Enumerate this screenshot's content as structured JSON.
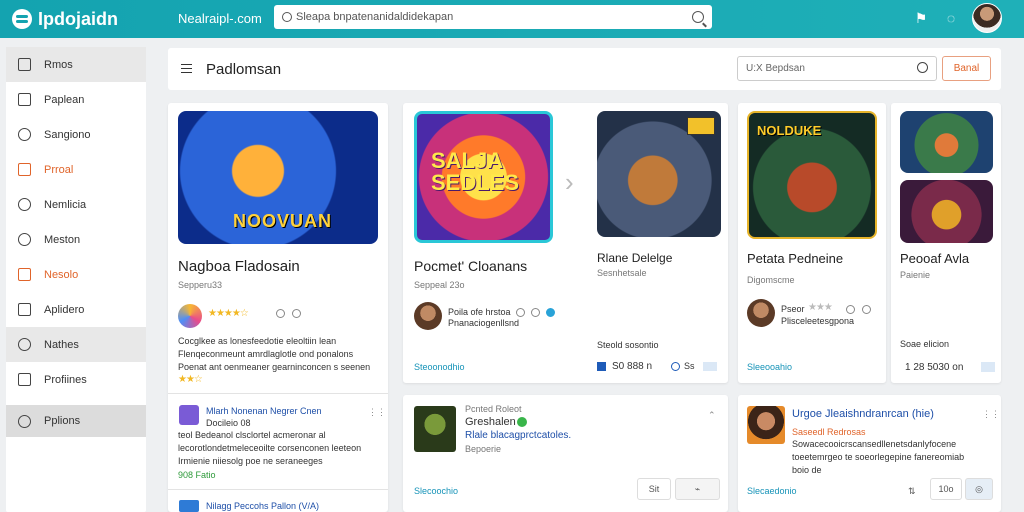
{
  "app": {
    "title": "Ipdojaidn",
    "subtitle": "Nealraipl-.com"
  },
  "search": {
    "placeholder": "Sleapa bnpatenanidaldidekapan"
  },
  "sidebar": {
    "items": [
      {
        "label": "Rmos",
        "icon": "square-icon"
      },
      {
        "label": "Paplean",
        "icon": "list-icon"
      },
      {
        "label": "Sangiono",
        "icon": "circle-icon"
      },
      {
        "label": "Prroal",
        "icon": "shield-icon",
        "accent": true
      },
      {
        "label": "Nemlicia",
        "icon": "clock-icon"
      },
      {
        "label": "Meston",
        "icon": "globe-icon"
      },
      {
        "label": "Nesolo",
        "icon": "calendar-icon",
        "accent": true
      },
      {
        "label": "Aplidero",
        "icon": "grid-icon"
      },
      {
        "label": "Nathes",
        "icon": "chat-icon"
      },
      {
        "label": "Profiines",
        "icon": "file-icon"
      },
      {
        "label": "Pplions",
        "icon": "search-icon"
      }
    ]
  },
  "header": {
    "title": "Padlomsan",
    "filter_placeholder": "U:X Bepdsan",
    "button": "Banal"
  },
  "cards": {
    "c1": {
      "title": "Nagboa Fladosain",
      "sub": "Sepperu33",
      "desc": "Cocglkee as lonesfeedotie eleoltiin lean\nFlenqeconmeunt amrdlaglotle ond ponalons\nPoenat ant oenmeaner gearninconcen s seenen",
      "list1_title": "Mlarh Nonenan Negrer Cnen",
      "list1_sub": "Docileio 08",
      "list1_desc": "teol Bedeanol clsclortel acmeronar al\nlecorotlondetmeleceoilte corsenconen leeteon\nIrmienie niiesolg poe ne seraneeges",
      "list1_tag": "908 Fatio",
      "list2_title": "Nilagg Peccohs Pallon (V/A)"
    },
    "c2": {
      "title": "Pocmet' Cloanans",
      "sub": "Seppeal 23o",
      "meta1": "Poila ofe hrstoa",
      "meta2": "Pnanaciogenllsnd",
      "link": "Steoonodhio",
      "title2": "Rlane Delelge",
      "sub2": "Sesnhetsale",
      "small2": "Steold sosontio",
      "price": "S0 888 n",
      "badge": "Ss"
    },
    "c3": {
      "title": "Petata Pedneine",
      "sub": "Digomscme",
      "meta": "Pseor",
      "meta2": "Plisceleetesgpona",
      "link": "Sleeooahio"
    },
    "c4": {
      "title": "Peooaf Avla",
      "sub": "Paienie",
      "small": "Soae elicion",
      "price": "1 28 5030 on"
    },
    "c5": {
      "label": "Pcnted Roleot",
      "title": "Greshalen",
      "desc": "Rlale blacagprctcatoles.",
      "sub": "Bepoerie",
      "link": "Slecoochio",
      "btn": "Sit"
    },
    "c6": {
      "title": "Urgoe Jleaishndranrcan (hie)",
      "badge": "Saseedl Redrosas",
      "desc": "Sowacecooicrscansedllenetsdanlyfocene\ntoeetemrgeo te soeorlegepine fanereomiab\nboio de",
      "link": "Slecaedonio",
      "count": "10o"
    }
  },
  "colors": {
    "accent": "#14a3b0",
    "orange": "#e0642a",
    "link": "#1693b8"
  }
}
